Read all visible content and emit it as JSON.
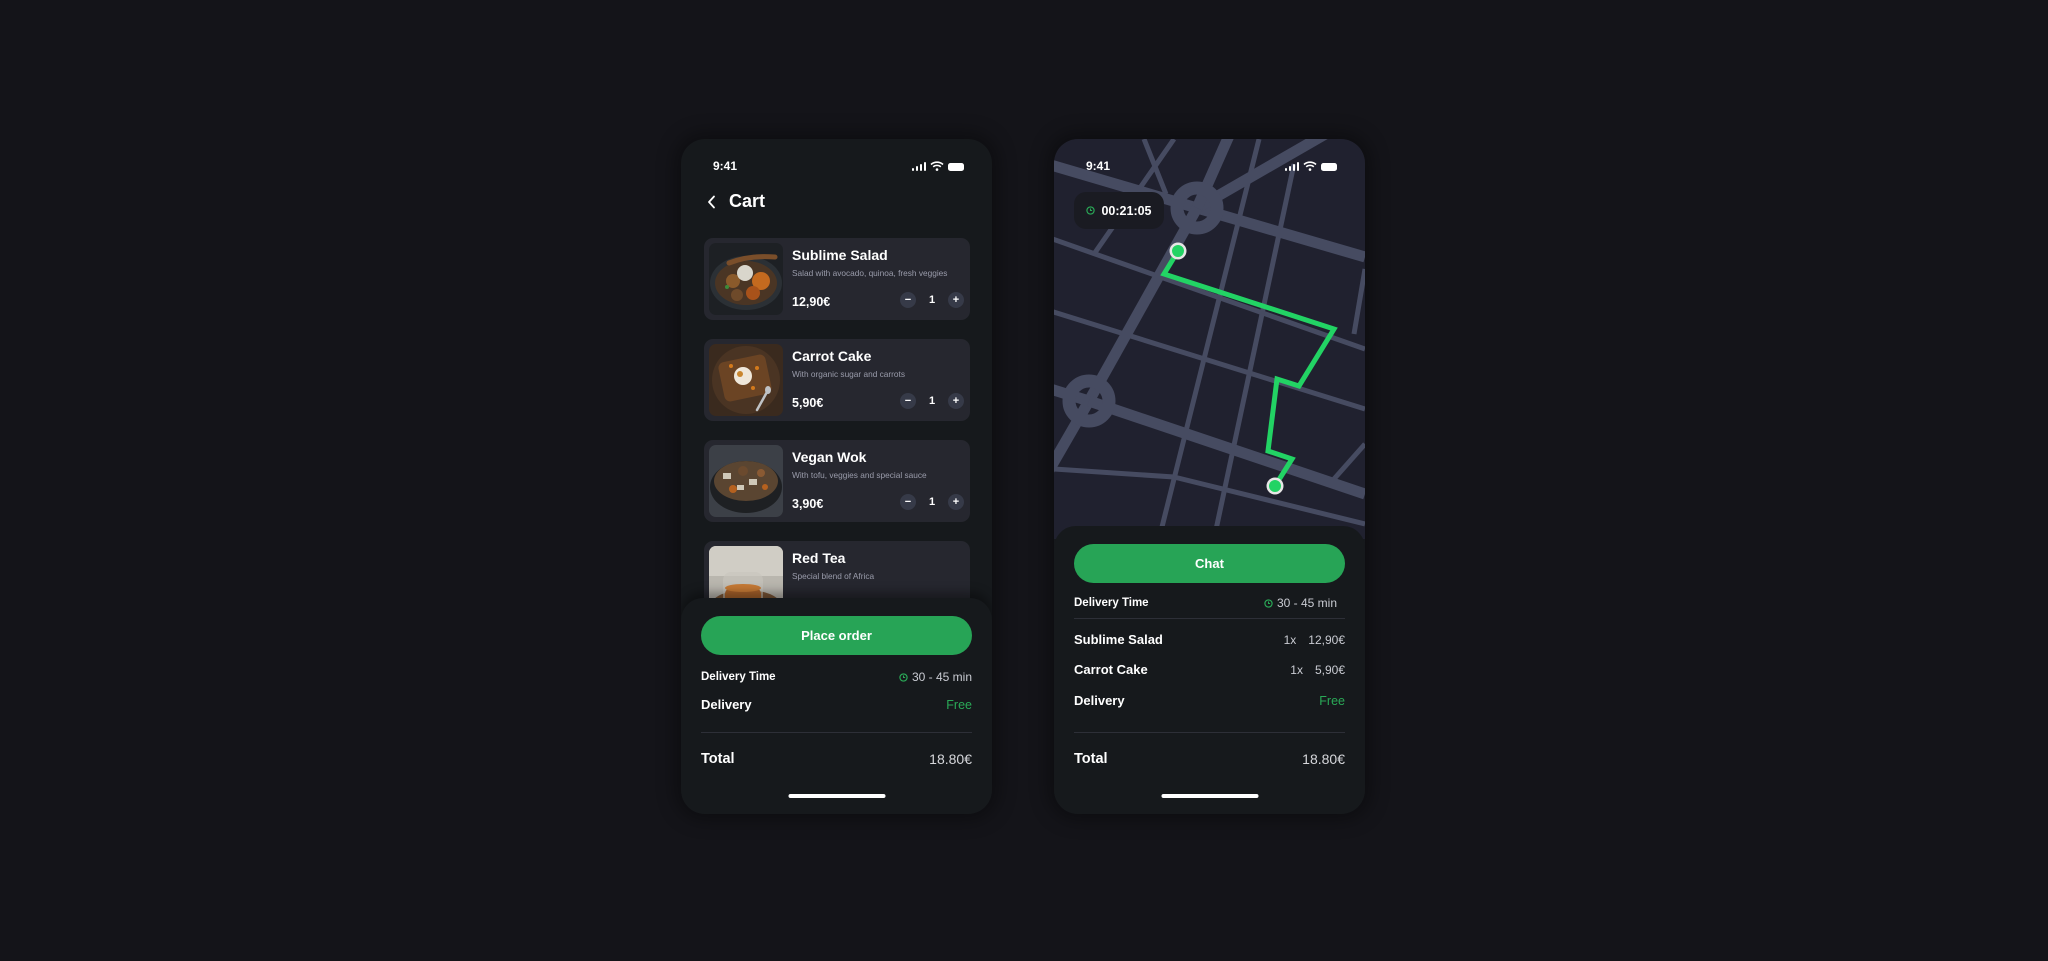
{
  "colors": {
    "page_bg": "#141419",
    "phone_bg": "#16191c",
    "card_bg": "#26272f",
    "accent_green": "#27a456",
    "route_green": "#22d364",
    "map_bg": "#20212f",
    "road": "#464b61"
  },
  "cart_screen": {
    "status": {
      "time": "9:41"
    },
    "header": {
      "back_icon": "chevron-left-icon",
      "title": "Cart"
    },
    "items": [
      {
        "name": "Sublime Salad",
        "description": "Salad with avocado, quinoa, fresh veggies",
        "price": "12,90€",
        "quantity": "1",
        "image": "salad-photo"
      },
      {
        "name": "Carrot Cake",
        "description": "With organic sugar and carrots",
        "price": "5,90€",
        "quantity": "1",
        "image": "cake-photo"
      },
      {
        "name": "Vegan Wok",
        "description": "With tofu, veggies and special sauce",
        "price": "3,90€",
        "quantity": "1",
        "image": "wok-photo"
      },
      {
        "name": "Red Tea",
        "description": "Special blend of Africa",
        "price": "",
        "quantity": "",
        "image": "tea-photo"
      }
    ],
    "qty_minus": "−",
    "qty_plus": "+",
    "summary": {
      "button_label": "Place order",
      "delivery_time_label": "Delivery Time",
      "delivery_time_value": "30 - 45 min",
      "delivery_label": "Delivery",
      "delivery_value": "Free",
      "total_label": "Total",
      "total_value": "18.80€"
    }
  },
  "tracking_screen": {
    "status": {
      "time": "9:41"
    },
    "timer": "00:21:05",
    "summary": {
      "button_label": "Chat",
      "delivery_time_label": "Delivery Time",
      "delivery_time_value": "30 - 45 min",
      "lines": [
        {
          "name": "Sublime Salad",
          "qty": "1x",
          "price": "12,90€"
        },
        {
          "name": "Carrot Cake",
          "qty": "1x",
          "price": "5,90€"
        }
      ],
      "delivery_label": "Delivery",
      "delivery_value": "Free",
      "total_label": "Total",
      "total_value": "18.80€"
    }
  }
}
